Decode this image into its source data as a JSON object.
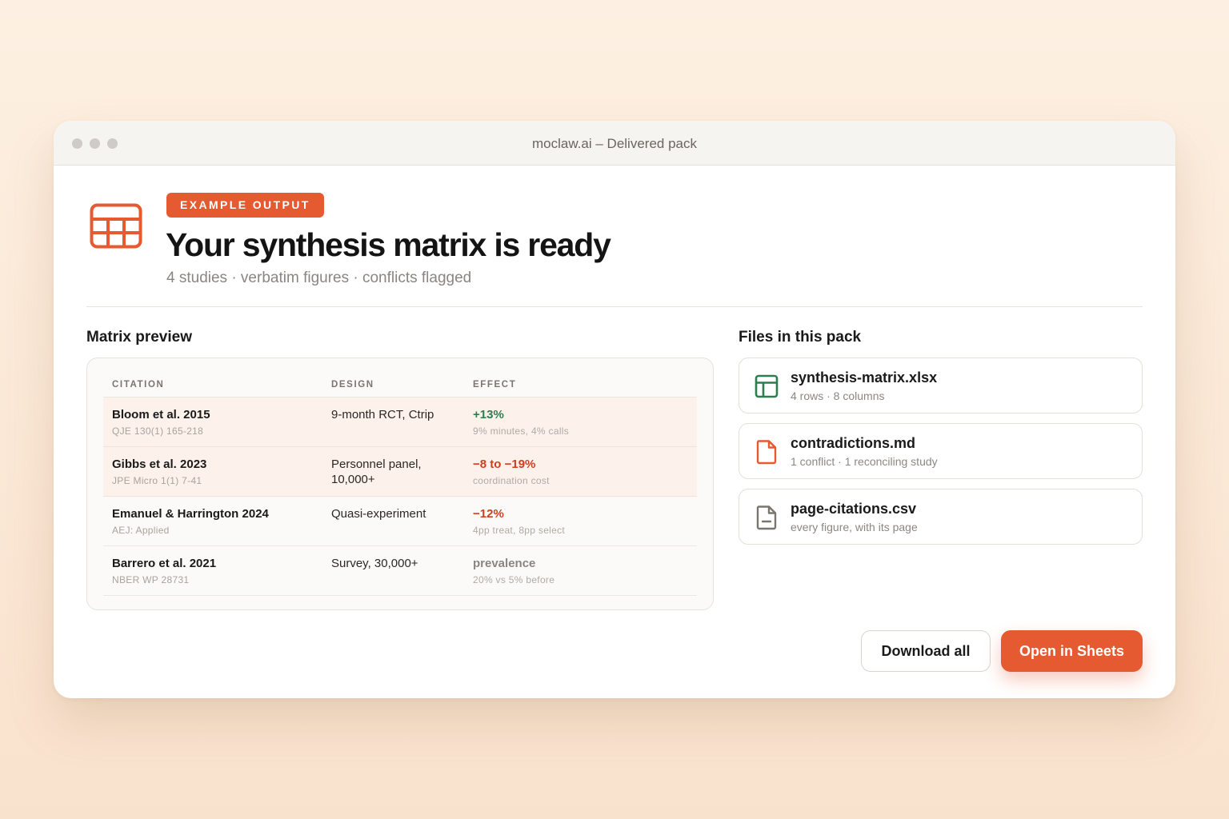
{
  "window": {
    "title": "moclaw.ai – Delivered pack"
  },
  "hero": {
    "icon": "table-icon",
    "badge": "EXAMPLE OUTPUT",
    "title": "Your synthesis matrix is ready",
    "subtitle": "4 studies · verbatim figures · conflicts flagged"
  },
  "matrix": {
    "section_title": "Matrix preview",
    "columns": [
      "CITATION",
      "DESIGN",
      "EFFECT"
    ],
    "rows": [
      {
        "citation": "Bloom et al. 2015",
        "source": "QJE 130(1) 165-218",
        "design": "9-month RCT, Ctrip",
        "effect": "+13%",
        "effect_note": "9% minutes, 4% calls",
        "tone": "positive",
        "highlighted": true
      },
      {
        "citation": "Gibbs et al. 2023",
        "source": "JPE Micro 1(1) 7-41",
        "design": "Personnel panel, 10,000+",
        "effect": "−8 to −19%",
        "effect_note": "coordination cost",
        "tone": "negative",
        "highlighted": true
      },
      {
        "citation": "Emanuel & Harrington 2024",
        "source": "AEJ: Applied",
        "design": "Quasi-experiment",
        "effect": "−12%",
        "effect_note": "4pp treat, 8pp select",
        "tone": "negative",
        "highlighted": false
      },
      {
        "citation": "Barrero et al. 2021",
        "source": "NBER WP 28731",
        "design": "Survey, 30,000+",
        "effect": "prevalence",
        "effect_note": "20% vs 5% before",
        "tone": "neutral",
        "highlighted": false
      }
    ]
  },
  "files": {
    "section_title": "Files in this pack",
    "items": [
      {
        "name": "synthesis-matrix.xlsx",
        "meta": "4 rows · 8 columns",
        "icon": "spreadsheet-icon"
      },
      {
        "name": "contradictions.md",
        "meta": "1 conflict · 1 reconciling study",
        "icon": "document-icon"
      },
      {
        "name": "page-citations.csv",
        "meta": "every figure, with its page",
        "icon": "csv-file-icon"
      }
    ]
  },
  "actions": {
    "download_all": "Download all",
    "open_in_sheets": "Open in Sheets"
  },
  "colors": {
    "accent": "#e65a31",
    "positive": "#2e7d4f",
    "negative": "#cf3e1e",
    "neutral": "#8a8580"
  }
}
